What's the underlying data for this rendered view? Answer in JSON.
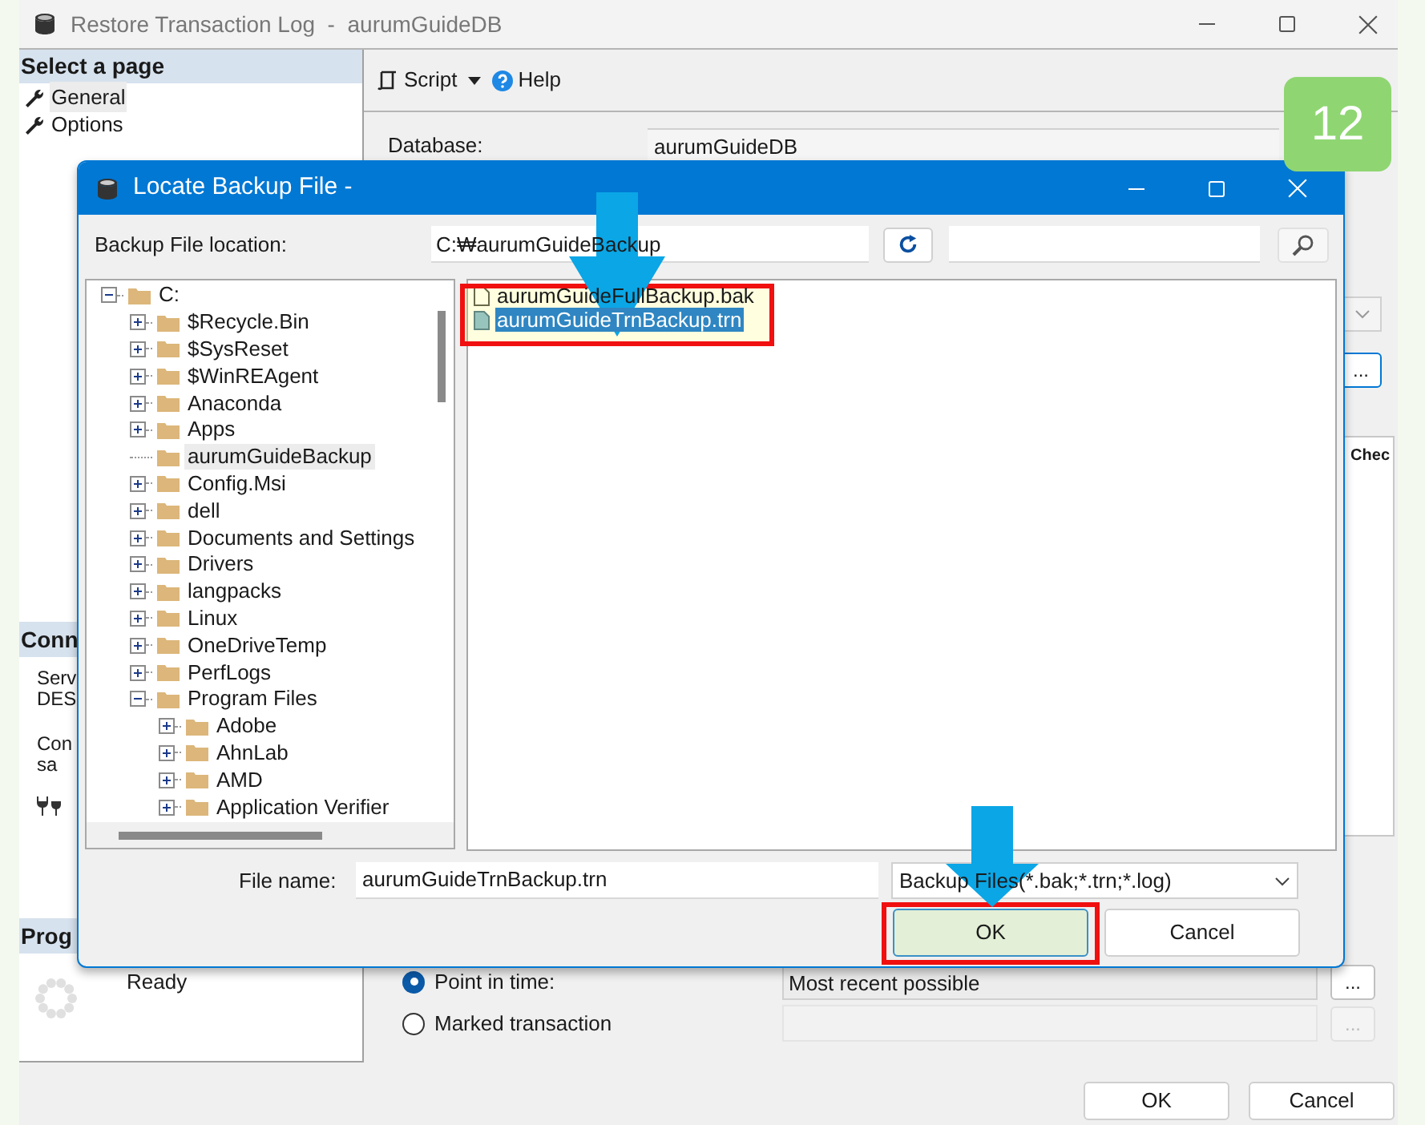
{
  "window": {
    "title": "Restore Transaction Log  -  aurumGuideDB"
  },
  "sidebar": {
    "header": "Select a page",
    "items": [
      {
        "label": "General",
        "selected": true
      },
      {
        "label": "Options",
        "selected": false
      }
    ],
    "connection": {
      "header": "Conn",
      "lines": [
        "Serv",
        "DES",
        "Con",
        "sa"
      ]
    },
    "progress": {
      "header": "Prog",
      "status": "Ready"
    }
  },
  "toolbar": {
    "script": "Script",
    "help": "Help"
  },
  "database": {
    "label": "Database:",
    "value": "aurumGuideDB"
  },
  "right_edge": {
    "browse": "...",
    "column_header": "Chec"
  },
  "restore_to": [
    {
      "label": "Point in time:",
      "selected": true,
      "value": "Most recent possible",
      "disabled": false,
      "browse": "..."
    },
    {
      "label": "Marked transaction",
      "selected": false,
      "disabled": true,
      "browse": "..."
    }
  ],
  "buttons": [
    {
      "label": "OK"
    },
    {
      "label": "Cancel"
    }
  ],
  "dialog": {
    "title": "Locate Backup File -",
    "location_label": "Backup File location:",
    "location": "C:₩aurumGuideBackup",
    "tree": [
      {
        "label": "C:",
        "expandable": true,
        "expanded": true,
        "selected": false,
        "children": [
          {
            "label": "$Recycle.Bin",
            "expandable": true,
            "expanded": false,
            "selected": false
          },
          {
            "label": "$SysReset",
            "expandable": true,
            "expanded": false,
            "selected": false
          },
          {
            "label": "$WinREAgent",
            "expandable": true,
            "expanded": false,
            "selected": false
          },
          {
            "label": "Anaconda",
            "expandable": true,
            "expanded": false,
            "selected": false
          },
          {
            "label": "Apps",
            "expandable": true,
            "expanded": false,
            "selected": false
          },
          {
            "label": "aurumGuideBackup",
            "expandable": false,
            "expanded": false,
            "selected": true
          },
          {
            "label": "Config.Msi",
            "expandable": true,
            "expanded": false,
            "selected": false
          },
          {
            "label": "dell",
            "expandable": true,
            "expanded": false,
            "selected": false
          },
          {
            "label": "Documents and Settings",
            "expandable": true,
            "expanded": false,
            "selected": false
          },
          {
            "label": "Drivers",
            "expandable": true,
            "expanded": false,
            "selected": false
          },
          {
            "label": "langpacks",
            "expandable": true,
            "expanded": false,
            "selected": false
          },
          {
            "label": "Linux",
            "expandable": true,
            "expanded": false,
            "selected": false
          },
          {
            "label": "OneDriveTemp",
            "expandable": true,
            "expanded": false,
            "selected": false
          },
          {
            "label": "PerfLogs",
            "expandable": true,
            "expanded": false,
            "selected": false
          },
          {
            "label": "Program Files",
            "expandable": true,
            "expanded": true,
            "selected": false,
            "children": [
              {
                "label": "Adobe",
                "expandable": true,
                "expanded": false,
                "selected": false
              },
              {
                "label": "AhnLab",
                "expandable": true,
                "expanded": false,
                "selected": false
              },
              {
                "label": "AMD",
                "expandable": true,
                "expanded": false,
                "selected": false
              },
              {
                "label": "Application Verifier",
                "expandable": true,
                "expanded": false,
                "selected": false
              }
            ]
          }
        ]
      }
    ],
    "files": [
      {
        "name": "aurumGuideFullBackup.bak",
        "selected": false
      },
      {
        "name": "aurumGuideTrnBackup.trn",
        "selected": true
      }
    ],
    "file_name_label": "File name:",
    "file_name": "aurumGuideTrnBackup.trn",
    "filter": "Backup Files(*.bak;*.trn;*.log)",
    "buttons": [
      {
        "label": "OK",
        "default": true
      },
      {
        "label": "Cancel",
        "default": false
      }
    ]
  },
  "annotations": {
    "step": "12"
  }
}
